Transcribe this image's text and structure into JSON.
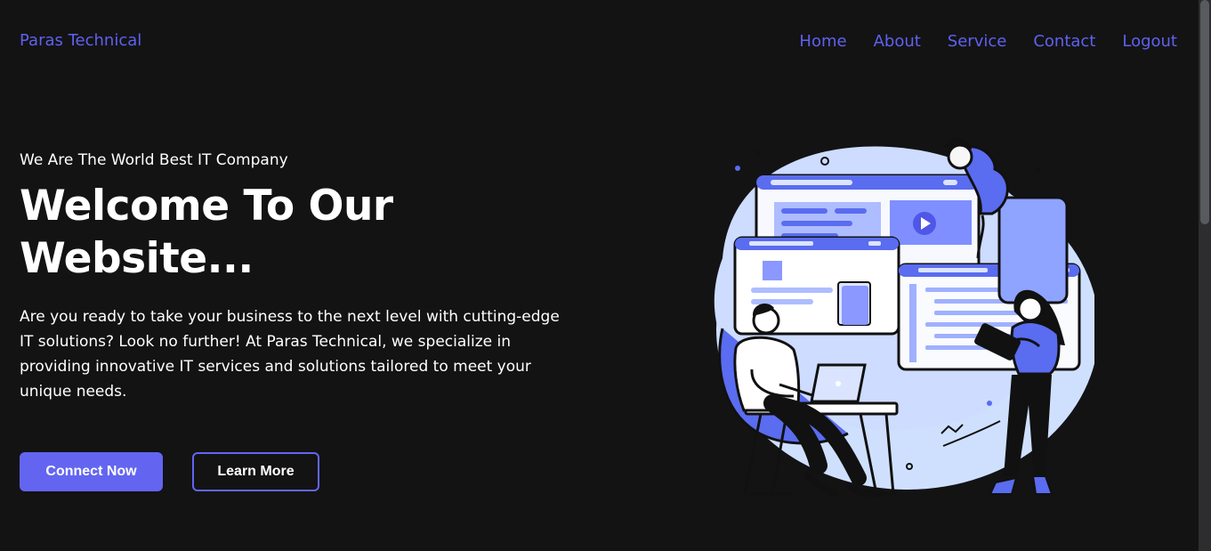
{
  "brand": {
    "name": "Paras Technical",
    "accent_color": "#5f61ef"
  },
  "nav": {
    "links": [
      "Home",
      "About",
      "Service",
      "Contact",
      "Logout"
    ]
  },
  "hero": {
    "eyebrow": "We Are The World Best IT Company",
    "title": "Welcome To Our Website...",
    "description": "Are you ready to take your business to the next level with cutting-edge IT solutions? Look no further! At Paras Technical, we specialize in providing innovative IT services and solutions tailored to meet your unique needs.",
    "primary_button": "Connect Now",
    "secondary_button": "Learn More"
  },
  "illustration": {
    "subject": "developers-workspace-illustration"
  },
  "colors": {
    "background": "#131314",
    "text": "#ffffff",
    "button": "#6365f1",
    "illustration_blue": "#5a6cf0",
    "illustration_light": "#cfe0ff"
  }
}
